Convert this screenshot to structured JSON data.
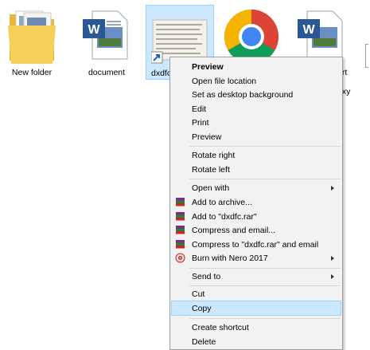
{
  "desktop": {
    "items": [
      {
        "label": "New folder",
        "icon": "folder-icon"
      },
      {
        "label": "document",
        "icon": "word-document-icon"
      },
      {
        "label": "dxdfc",
        "icon": "image-shortcut-icon"
      },
      {
        "label": "",
        "icon": "chrome-icon"
      },
      {
        "label": "",
        "icon": "word-document-icon"
      }
    ],
    "partial_label_1": "ort",
    "partial_label_2": "axy"
  },
  "context_menu": {
    "items": [
      {
        "label": "Preview",
        "bold": true
      },
      {
        "label": "Open file location"
      },
      {
        "label": "Set as desktop background"
      },
      {
        "label": "Edit"
      },
      {
        "label": "Print"
      },
      {
        "label": "Preview"
      },
      {
        "label": "Rotate right"
      },
      {
        "label": "Rotate left"
      },
      {
        "label": "Open with",
        "submenu": true
      },
      {
        "label": "Add to archive...",
        "icon": "winrar-icon"
      },
      {
        "label": "Add to \"dxdfc.rar\"",
        "icon": "winrar-icon"
      },
      {
        "label": "Compress and email...",
        "icon": "winrar-icon"
      },
      {
        "label": "Compress to \"dxdfc.rar\" and email",
        "icon": "winrar-icon"
      },
      {
        "label": "Burn with Nero 2017",
        "icon": "nero-icon",
        "submenu": true
      },
      {
        "label": "Send to",
        "submenu": true
      },
      {
        "label": "Cut"
      },
      {
        "label": "Copy",
        "highlighted": true
      },
      {
        "label": "Create shortcut"
      },
      {
        "label": "Delete"
      }
    ]
  },
  "colors": {
    "selection_bg": "#cce8ff",
    "selection_border": "#99d1ff",
    "menu_bg": "#f2f2f2"
  }
}
